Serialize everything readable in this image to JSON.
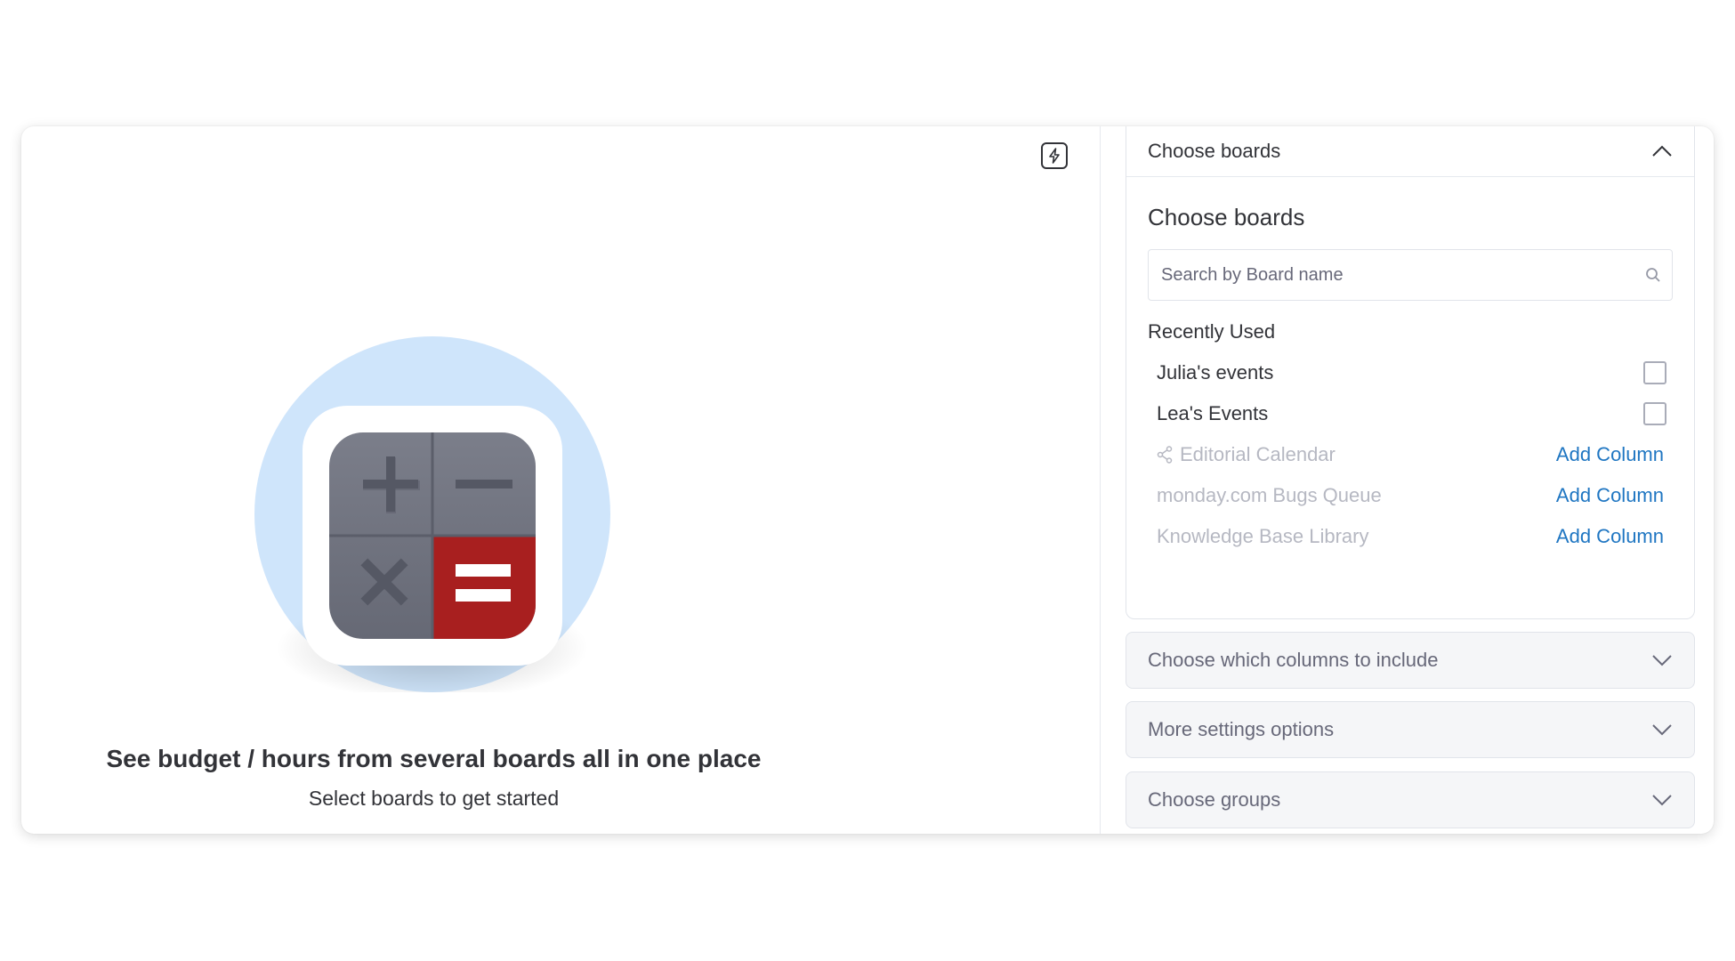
{
  "hero": {
    "title": "See budget / hours from several boards all in one place",
    "subtitle": "Select boards to get started"
  },
  "settings": {
    "choose_boards": {
      "header": "Choose boards",
      "title": "Choose boards",
      "search_placeholder": "Search by Board name",
      "recently_used_label": "Recently Used",
      "boards": [
        {
          "name": "Julia's events",
          "action": "checkbox",
          "enabled": true
        },
        {
          "name": "Lea's Events",
          "action": "checkbox",
          "enabled": true
        },
        {
          "name": "Editorial Calendar",
          "action": "Add Column",
          "enabled": false,
          "icon": "share-icon"
        },
        {
          "name": "monday.com Bugs Queue",
          "action": "Add Column",
          "enabled": false
        },
        {
          "name": "Knowledge Base Library",
          "action": "Add Column",
          "enabled": false
        }
      ]
    },
    "collapsed_sections": [
      {
        "title": "Choose which columns to include"
      },
      {
        "title": "More settings options"
      },
      {
        "title": "Choose groups"
      }
    ]
  },
  "colors": {
    "accent_link": "#1f76c2",
    "hero_circle": "#cfe5fb",
    "equals_red": "#a81f1f",
    "calculator_gray": "#6f7280"
  }
}
